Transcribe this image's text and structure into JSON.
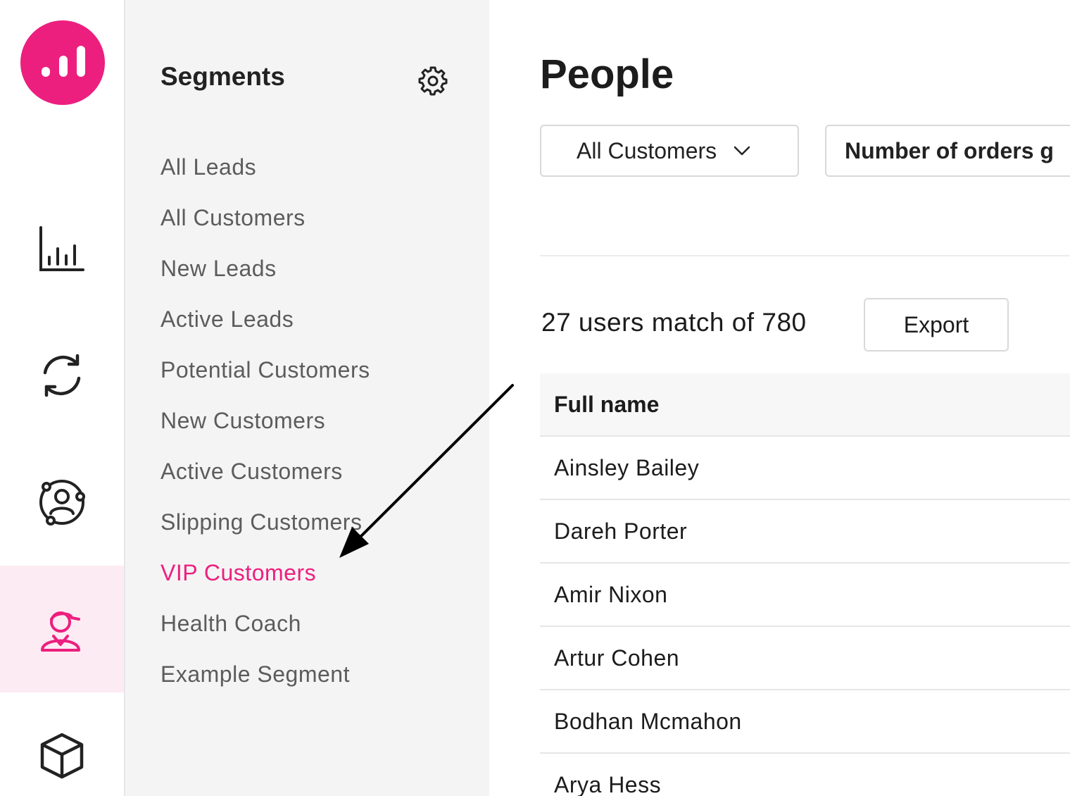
{
  "rail": {
    "logo_icon": "bar-chart-logo",
    "items": [
      {
        "icon": "analytics-icon",
        "active": false
      },
      {
        "icon": "sync-icon",
        "active": false
      },
      {
        "icon": "contacts-icon",
        "active": false
      },
      {
        "icon": "people-icon",
        "active": true
      },
      {
        "icon": "box-icon",
        "active": false
      }
    ]
  },
  "segments": {
    "title": "Segments",
    "settings_icon": "gear-icon",
    "items": [
      {
        "label": "All Leads"
      },
      {
        "label": "All Customers"
      },
      {
        "label": "New Leads"
      },
      {
        "label": "Active Leads"
      },
      {
        "label": "Potential Customers"
      },
      {
        "label": "New Customers"
      },
      {
        "label": "Active Customers"
      },
      {
        "label": "Slipping Customers"
      },
      {
        "label": "VIP Customers"
      },
      {
        "label": "Health Coach"
      },
      {
        "label": "Example Segment"
      }
    ],
    "active_label": "VIP Customers"
  },
  "main": {
    "title": "People",
    "filters": {
      "segment_select": "All Customers",
      "condition": "Number of orders g"
    },
    "summary": "27 users match of 780",
    "export_label": "Export",
    "table": {
      "header": "Full name",
      "rows": [
        "Ainsley Bailey",
        "Dareh Porter",
        "Amir Nixon",
        "Artur Cohen",
        "Bodhan Mcmahon",
        "Arya Hess"
      ]
    }
  },
  "colors": {
    "accent": "#ec1f7f",
    "accent_bg": "#fdebf3",
    "panel_bg": "#f4f4f4"
  }
}
